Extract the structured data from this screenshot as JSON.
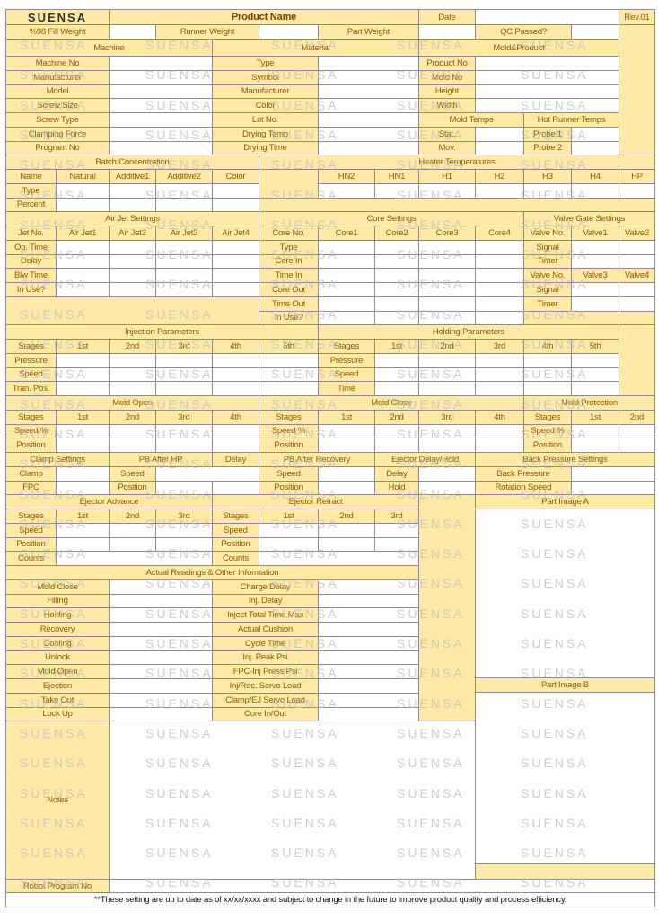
{
  "header": {
    "logo": "SUENSA",
    "product_name": "Product Name",
    "date": "Date",
    "rev": "Rev.01"
  },
  "weights": {
    "fill": "%98 Fill Weight",
    "runner": "Runner Weight",
    "part": "Part Weight",
    "qc": "QC Passed?"
  },
  "sections": {
    "machine": "Machine",
    "material": "Material",
    "mold_product": "Mold&Product"
  },
  "machine_labels": [
    "Machine No",
    "Manufacturer",
    "Model",
    "Screw Size",
    "Screw Type",
    "Clamping Force",
    "Program No"
  ],
  "material_labels": [
    "Type",
    "Symbol",
    "Manufacturer",
    "Color",
    "Lot No.",
    "Drying Temp",
    "Drying Time"
  ],
  "mold_labels": [
    "Product No",
    "Mold No",
    "Height",
    "Width"
  ],
  "mold_temps": "Mold Temps",
  "hot_runner_temps": "Hot Runner Temps",
  "mold_temp_labels": [
    "Stat.",
    "Mov."
  ],
  "probes": [
    "Probe 1",
    "Probe 2"
  ],
  "batch": {
    "title": "Batch Concentration",
    "columns": [
      "Name",
      "Natural",
      "Additive1",
      "Additive2",
      "Color"
    ],
    "rows": [
      "Type",
      "Percent"
    ]
  },
  "heater": {
    "title": "Heater Temperatures",
    "columns": [
      "HN2",
      "HN1",
      "H1",
      "H2",
      "H3",
      "H4",
      "HP"
    ]
  },
  "air_jet": {
    "title": "Air Jet Settings",
    "columns": [
      "Jet No.",
      "Air Jet1",
      "Air Jet2",
      "Air Jet3",
      "Air Jet4"
    ],
    "rows": [
      "Op. Time",
      "Delay",
      "Blw Time",
      "In Use?"
    ]
  },
  "core": {
    "title": "Core Settings",
    "columns": [
      "Core No.",
      "Core1",
      "Core2",
      "Core3",
      "Core4"
    ],
    "rows": [
      "Type",
      "Core In",
      "Time In",
      "Core Out",
      "Time Out",
      "In Use?"
    ]
  },
  "valve_gate": {
    "title": "Valve Gate Settings",
    "columns": [
      "Valve No.",
      "Valve1",
      "Valve2"
    ],
    "columns2": [
      "Valve No.",
      "Valve3",
      "Valve4"
    ],
    "rows": [
      "Signal",
      "Timer"
    ]
  },
  "injection": {
    "title": "Injection Parameters",
    "columns": [
      "Stages",
      "1st",
      "2nd",
      "3rd",
      "4th",
      "5th"
    ],
    "rows": [
      "Pressure",
      "Speed",
      "Tran. Pos."
    ]
  },
  "holding": {
    "title": "Holding Parameters",
    "columns": [
      "Stages",
      "1st",
      "2nd",
      "3rd",
      "4th",
      "5th"
    ],
    "rows": [
      "Pressure",
      "Speed",
      "Time"
    ]
  },
  "mold_open": {
    "title": "Mold Open",
    "columns": [
      "Stages",
      "1st",
      "2nd",
      "3rd",
      "4th"
    ],
    "rows": [
      "Speed %",
      "Position"
    ]
  },
  "mold_close": {
    "title": "Mold Close",
    "columns": [
      "Stages",
      "1st",
      "2nd",
      "3rd",
      "4th"
    ],
    "rows": [
      "Speed %",
      "Position"
    ]
  },
  "mold_protection": {
    "title": "Mold Protection",
    "columns": [
      "Stages",
      "1st",
      "2nd"
    ],
    "rows": [
      "Speed %",
      "Position"
    ]
  },
  "clamp": {
    "title": "Clamp Settings",
    "rows": [
      "Clamp",
      "FPC"
    ]
  },
  "pb_after_hp": {
    "title": "PB After HP",
    "rows": [
      "Speed",
      "Position"
    ]
  },
  "delay": "Delay",
  "pb_after_recovery": {
    "title": "PB After Recovery",
    "rows": [
      "Speed",
      "Position"
    ]
  },
  "ejector_delay": {
    "title": "Ejector Delay/Hold",
    "rows": [
      "Delay",
      "Hold"
    ]
  },
  "back_pressure": {
    "title": "Back Pressure Settings",
    "rows": [
      "Back Pressure",
      "Rotation Speed"
    ]
  },
  "ejector_advance": {
    "title": "Ejector Advance",
    "columns": [
      "Stages",
      "1st",
      "2nd",
      "3rd"
    ],
    "rows": [
      "Speed",
      "Position",
      "Counts"
    ]
  },
  "ejector_retract": {
    "title": "Ejector Retract",
    "columns": [
      "Stages",
      "1st",
      "2nd",
      "3rd"
    ],
    "rows": [
      "Speed",
      "Position",
      "Counts"
    ]
  },
  "actual": {
    "title": "Actual Readings & Other Information",
    "left": [
      "Mold Close",
      "Filling",
      "Holding",
      "Recovery",
      "Cooling",
      "Unlock",
      "Mold Open",
      "Ejection",
      "Take Out",
      "Lock Up"
    ],
    "right": [
      "Charge Delay",
      "Inj. Delay",
      "Inject Total Time Max",
      "Actual Cushion",
      "Cycle Time",
      "Inj. Peak Psi",
      "FPC-Inj Press Psi",
      "Inj/Rec. Servo Load",
      "Clamp/EJ Servo Load",
      "Core In/Out"
    ]
  },
  "part_image_a": "Part Image A",
  "part_image_b": "Part Image B",
  "notes": "Notes",
  "robot": "Robot Program No",
  "footer": "**These setting are up to date as of xx/xx/xxxx and subject to change in the future to improve product quality and process efficiency.",
  "colors": {
    "label_fill": "#ffe9a6",
    "label_text": "#8a5c00",
    "border": "#8c8c8c",
    "watermark": "#bdbdbd"
  }
}
